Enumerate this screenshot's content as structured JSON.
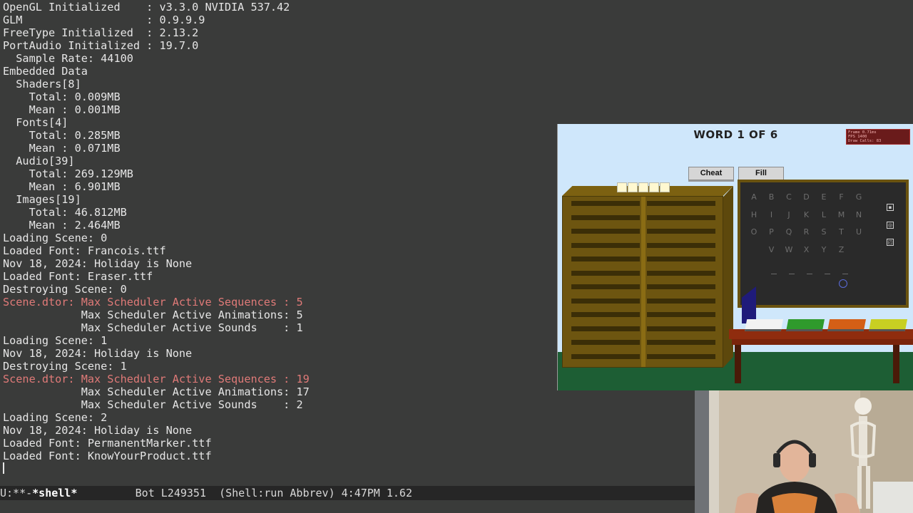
{
  "terminal": {
    "lines": [
      {
        "text": "OpenGL Initialized    : v3.3.0 NVIDIA 537.42",
        "style": "normal"
      },
      {
        "text": "GLM                   : 0.9.9.9",
        "style": "normal"
      },
      {
        "text": "FreeType Initialized  : 2.13.2",
        "style": "normal"
      },
      {
        "text": "PortAudio Initialized : 19.7.0",
        "style": "normal"
      },
      {
        "text": "  Sample Rate: 44100",
        "style": "normal"
      },
      {
        "text": "Embedded Data",
        "style": "normal"
      },
      {
        "text": "  Shaders[8]",
        "style": "normal"
      },
      {
        "text": "    Total: 0.009MB",
        "style": "normal"
      },
      {
        "text": "    Mean : 0.001MB",
        "style": "normal"
      },
      {
        "text": "  Fonts[4]",
        "style": "normal"
      },
      {
        "text": "    Total: 0.285MB",
        "style": "normal"
      },
      {
        "text": "    Mean : 0.071MB",
        "style": "normal"
      },
      {
        "text": "  Audio[39]",
        "style": "normal"
      },
      {
        "text": "    Total: 269.129MB",
        "style": "normal"
      },
      {
        "text": "    Mean : 6.901MB",
        "style": "normal"
      },
      {
        "text": "  Images[19]",
        "style": "normal"
      },
      {
        "text": "    Total: 46.812MB",
        "style": "normal"
      },
      {
        "text": "    Mean : 2.464MB",
        "style": "normal"
      },
      {
        "text": "Loading Scene: 0",
        "style": "normal"
      },
      {
        "text": "Loaded Font: Francois.ttf",
        "style": "normal"
      },
      {
        "text": "Nov 18, 2024: Holiday is None",
        "style": "normal"
      },
      {
        "text": "Loaded Font: Eraser.ttf",
        "style": "normal"
      },
      {
        "text": "Destroying Scene: 0",
        "style": "normal"
      },
      {
        "text": "Scene.dtor: Max Scheduler Active Sequences : 5",
        "style": "warn"
      },
      {
        "text": "            Max Scheduler Active Animations: 5",
        "style": "normal"
      },
      {
        "text": "            Max Scheduler Active Sounds    : 1",
        "style": "normal"
      },
      {
        "text": "Loading Scene: 1",
        "style": "normal"
      },
      {
        "text": "Nov 18, 2024: Holiday is None",
        "style": "normal"
      },
      {
        "text": "Destroying Scene: 1",
        "style": "normal"
      },
      {
        "text": "Scene.dtor: Max Scheduler Active Sequences : 19",
        "style": "warn"
      },
      {
        "text": "            Max Scheduler Active Animations: 17",
        "style": "normal"
      },
      {
        "text": "            Max Scheduler Active Sounds    : 2",
        "style": "normal"
      },
      {
        "text": "Loading Scene: 2",
        "style": "normal"
      },
      {
        "text": "Nov 18, 2024: Holiday is None",
        "style": "normal"
      },
      {
        "text": "Loaded Font: PermanentMarker.ttf",
        "style": "normal"
      },
      {
        "text": "Loaded Font: KnowYourProduct.ttf",
        "style": "normal"
      }
    ]
  },
  "modeline": {
    "status": "U:**-",
    "buffer": "*shell*",
    "position": "Bot L249351",
    "modes": "(Shell:run Abbrev)",
    "time_load": "4:47PM 1.62"
  },
  "game": {
    "title": "WORD 1 OF 6",
    "cheat_label": "Cheat",
    "fill_label": "Fill",
    "debug": [
      "Frame  0.71ms",
      "FPS    1400",
      "Draw Calls: 83"
    ],
    "word_tile_count": 5,
    "alphabet_rows": [
      [
        "A",
        "B",
        "C",
        "D",
        "E",
        "F",
        "G"
      ],
      [
        "H",
        "I",
        "J",
        "K",
        "L",
        "M",
        "N"
      ],
      [
        "O",
        "P",
        "Q",
        "R",
        "S",
        "T",
        "U"
      ],
      [
        "V",
        "W",
        "X",
        "Y",
        "Z"
      ]
    ],
    "blank_count": 5,
    "books": [
      {
        "name": "white",
        "color": "#f2f2f2"
      },
      {
        "name": "green",
        "color": "#2f9a2c"
      },
      {
        "name": "orange",
        "color": "#d45f16"
      },
      {
        "name": "yellow",
        "color": "#c8cf22"
      }
    ],
    "colors": {
      "sky": "#cfe7fb",
      "floor": "#1d5e34",
      "wood": "#6d5510",
      "desk": "#8f2c0e",
      "board": "#2a2a2a"
    }
  }
}
